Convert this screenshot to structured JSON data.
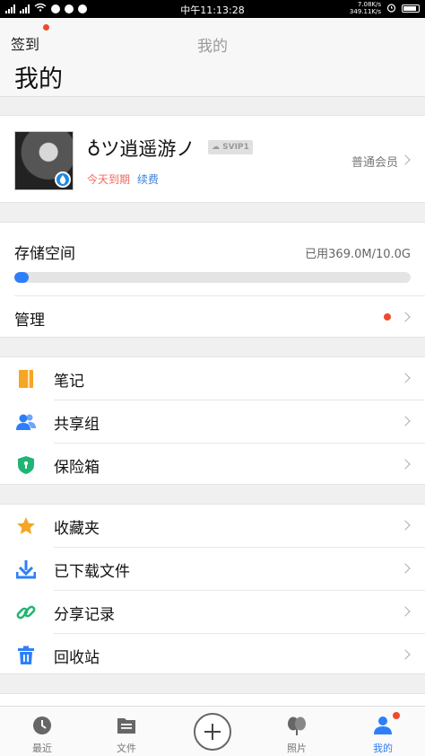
{
  "status_bar": {
    "time": "中午11:13:28",
    "net_up": "7.08K/s",
    "net_down": "349.11K/s"
  },
  "header": {
    "checkin_label": "签到",
    "nav_title": "我的",
    "big_title": "我的"
  },
  "profile": {
    "nickname": "♁ツ逍遥游ノ",
    "vip_badge": "SVIP1",
    "expire_text": "今天到期",
    "renew_text": "续费",
    "member_level": "普通会员"
  },
  "storage": {
    "label": "存储空间",
    "used_text": "已用369.0M/10.0G",
    "used_fraction": 0.036,
    "manage_label": "管理"
  },
  "tools": [
    {
      "label": "笔记",
      "icon": "note-icon",
      "color": "#f5a623"
    },
    {
      "label": "共享组",
      "icon": "share-group-icon",
      "color": "#2d7ff9"
    },
    {
      "label": "保险箱",
      "icon": "safe-box-icon",
      "color": "#21b573"
    }
  ],
  "collections": [
    {
      "label": "收藏夹",
      "icon": "star-icon",
      "color": "#f5a623"
    },
    {
      "label": "已下载文件",
      "icon": "download-icon",
      "color": "#2d7ff9"
    },
    {
      "label": "分享记录",
      "icon": "link-icon",
      "color": "#21b573"
    },
    {
      "label": "回收站",
      "icon": "trash-icon",
      "color": "#2d7ff9"
    }
  ],
  "tabs": [
    {
      "label": "最近",
      "icon": "clock-icon"
    },
    {
      "label": "文件",
      "icon": "folder-icon"
    },
    {
      "label": "照片",
      "icon": "photos-icon"
    },
    {
      "label": "我的",
      "icon": "user-icon"
    }
  ],
  "colors": {
    "accent": "#2d7ff9",
    "notify_dot": "#f04a2d",
    "expire": "#f0695a"
  }
}
